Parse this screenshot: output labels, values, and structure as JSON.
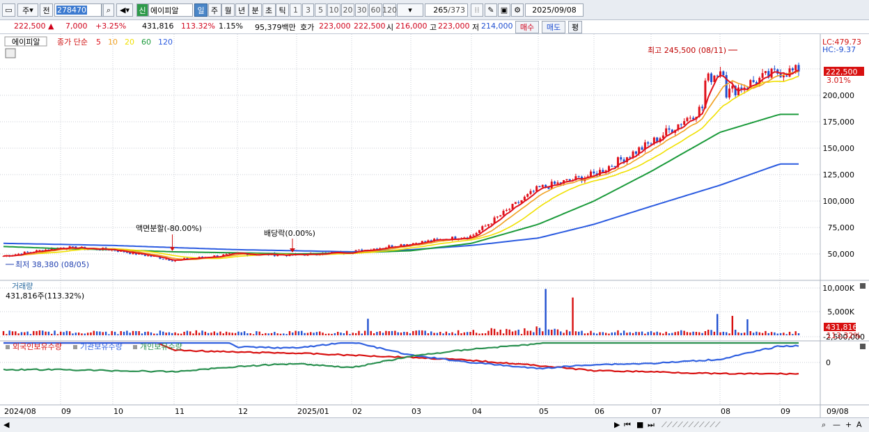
{
  "toolbar": {
    "type_label": "주",
    "prev_label": "전",
    "code": "278470",
    "new_badge": "신",
    "stock_name": "에이피알",
    "periods": [
      "일",
      "주",
      "월",
      "년",
      "분",
      "초",
      "틱"
    ],
    "active_period": "일",
    "intervals": [
      "1",
      "3",
      "5",
      "10",
      "20",
      "30",
      "60",
      "120"
    ],
    "count": "265",
    "total": "/373",
    "date": "2025/09/08"
  },
  "info": {
    "price": "222,500",
    "arrow": "▲",
    "change": "7,000",
    "change_pct": "+3.25%",
    "volume": "431,816",
    "volume_ratio": "113.32%",
    "turnover": "1.15%",
    "amount": "95,379백만",
    "quote_label": "호가",
    "ask": "223,000",
    "bid": "222,500",
    "open_label": "시",
    "open": "216,000",
    "high_label": "고",
    "high": "223,000",
    "low_label": "저",
    "low": "214,000",
    "buy_button": "매수",
    "sell_button": "매도",
    "eval_button": "평"
  },
  "price_panel": {
    "stock_label": "에이피알",
    "ma_title": "종가 단순",
    "ma_periods": [
      "5",
      "10",
      "20",
      "60",
      "120"
    ],
    "ma_colors": [
      "#e0101a",
      "#f0a020",
      "#f0e000",
      "#1a9a3a",
      "#2a5ae0"
    ],
    "lc": "LC:479.73",
    "hc": "HC:-9.37",
    "current_price": "222,500",
    "current_pct": "3.01%",
    "high_note": "최고 245,500 (08/11)",
    "low_note": "최저 38,380 (08/05)",
    "split_note": "액면분할(-80.00%)",
    "dividend_note": "배당락(0.00%)"
  },
  "volume_panel": {
    "title": "거래량",
    "value": "431,816주(113.32%)",
    "current": "431,816",
    "current_pct": "113.32%"
  },
  "holders_panel": {
    "series": [
      "외국인보유수량",
      "기관보유수량",
      "개인보유수량"
    ],
    "colors": [
      "#d81010",
      "#3060e0",
      "#2a9050"
    ]
  },
  "x_labels": [
    "2024/08",
    "09",
    "10",
    "11",
    "12",
    "2025/01",
    "02",
    "03",
    "04",
    "05",
    "06",
    "07",
    "08",
    "09"
  ],
  "x_end_label": "09/08",
  "chart_data": [
    {
      "type": "candlestick",
      "title": "에이피알",
      "y_ticks": [
        "50,000",
        "75,000",
        "100,000",
        "125,000",
        "150,000",
        "175,000",
        "200,000",
        "225,000"
      ],
      "ylim": [
        30000,
        255000
      ],
      "months": [
        "2024/08",
        "09",
        "10",
        "11",
        "12",
        "2025/01",
        "02",
        "03",
        "04",
        "05",
        "06",
        "07",
        "08",
        "09"
      ],
      "close_monthly": [
        48000,
        56000,
        54000,
        44000,
        50000,
        49000,
        52000,
        60000,
        67000,
        112000,
        125000,
        155000,
        200000,
        222500
      ],
      "ma120_monthly": [
        60000,
        59000,
        58000,
        56000,
        54000,
        53000,
        52000,
        54000,
        58000,
        65000,
        78000,
        95000,
        115000,
        135000
      ],
      "ma60_monthly": [
        57000,
        55000,
        54000,
        52000,
        51000,
        50000,
        51000,
        53000,
        60000,
        78000,
        100000,
        128000,
        165000,
        182000
      ],
      "high": 245500,
      "low": 38380
    },
    {
      "type": "bar",
      "title": "거래량",
      "y_ticks": [
        "5,000K",
        "10,000K"
      ],
      "ylim": [
        0,
        11000
      ],
      "unit": "K",
      "spikes_monthly": [
        1200,
        1500,
        1200,
        1800,
        1000,
        1100,
        900,
        3500,
        2000,
        9800,
        1200,
        1500,
        4500,
        800
      ]
    },
    {
      "type": "line",
      "title": "보유수량",
      "y_ticks": [
        "0",
        "-2,500,000"
      ],
      "series": [
        {
          "name": "외국인보유수량",
          "values_monthly": [
            -4000000,
            -3800000,
            -3800000,
            -1200000,
            -1000000,
            -900000,
            -700000,
            -500000,
            -200000,
            300000,
            800000,
            900000,
            1100000,
            1100000
          ]
        },
        {
          "name": "기관보유수량",
          "values_monthly": [
            -3500000,
            -3700000,
            -3900000,
            -4200000,
            -1500000,
            -1400000,
            -2000000,
            -700000,
            0,
            600000,
            200000,
            100000,
            -300000,
            -1600000
          ]
        },
        {
          "name": "개인보유수량",
          "values_monthly": [
            700000,
            700000,
            800000,
            900000,
            400000,
            100000,
            500000,
            -600000,
            -1300000,
            -1800000,
            -3600000,
            -3900000,
            -3700000,
            -3200000
          ]
        }
      ]
    }
  ]
}
